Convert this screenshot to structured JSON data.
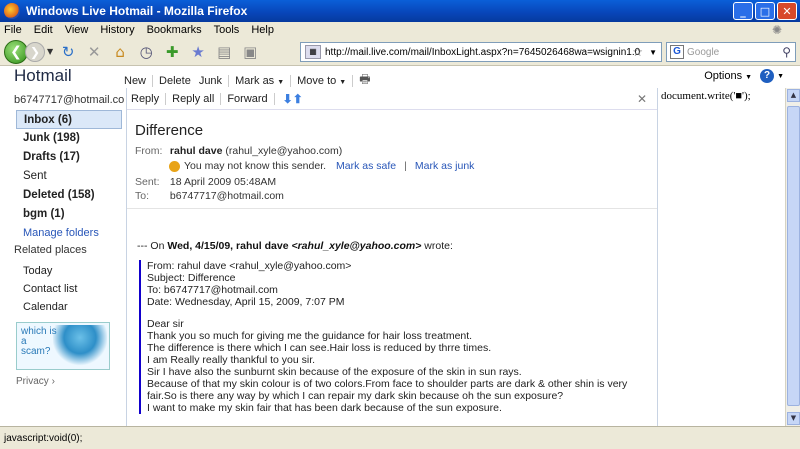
{
  "window": {
    "title": "Windows Live Hotmail - Mozilla Firefox"
  },
  "menu": [
    "File",
    "Edit",
    "View",
    "History",
    "Bookmarks",
    "Tools",
    "Help"
  ],
  "nav": {
    "url": "http://mail.live.com/mail/InboxLight.aspx?n=7645026468wa=wsignin1.0",
    "search_placeholder": "Google"
  },
  "hotmail": {
    "logo": "Hotmail",
    "actions": [
      "New",
      "Delete",
      "Junk",
      "Mark as",
      "Move to"
    ],
    "options": "Options"
  },
  "sidebar": {
    "account": "b6747717@hotmail.com",
    "folders": [
      {
        "label": "Inbox (6)"
      },
      {
        "label": "Junk (198)"
      },
      {
        "label": "Drafts (17)"
      },
      {
        "label": "Sent"
      },
      {
        "label": "Deleted (158)"
      },
      {
        "label": "bgm (1)"
      }
    ],
    "manage": "Manage folders",
    "related": "Related places",
    "places": [
      "Today",
      "Contact list",
      "Calendar"
    ],
    "ad_text": "which is a scam?",
    "privacy": "Privacy"
  },
  "message": {
    "toolbar": [
      "Reply",
      "Reply all",
      "Forward"
    ],
    "subject": "Difference",
    "from_label": "From:",
    "from_name": "rahul dave",
    "from_email": "(rahul_xyle@yahoo.com)",
    "warning": "You may not know this sender.",
    "mark_safe": "Mark as safe",
    "mark_junk": "Mark as junk",
    "sent_label": "Sent:",
    "sent": "18 April 2009 05:48AM",
    "to_label": "To:",
    "to": "b6747717@hotmail.com",
    "quote_prefix": "--- On ",
    "quote_date": "Wed, 4/15/09, rahul dave",
    "quote_email": "<rahul_xyle@yahoo.com>",
    "quote_suffix": " wrote:",
    "quoted_header": [
      "From: rahul dave <rahul_xyle@yahoo.com>",
      "Subject: Difference",
      "To: b6747717@hotmail.com",
      "Date: Wednesday, April 15, 2009, 7:07 PM"
    ],
    "body": [
      "Dear sir",
      "Thank you so much for giving me the guidance for hair loss treatment.",
      "The difference is there which I can see.Hair loss is reduced by thrre times.",
      "I am Really really thankful to you sir.",
      "Sir I have also the sunburnt skin because of the exposure of the skin in sun rays.",
      "Because of that my skin colour is of two colors.From face to shoulder parts are dark & other shin is very",
      "fair.So is there any way by which I can repair my dark skin because oh the sun exposure?",
      "I want to make my skin fair that has been dark because of the sun exposure."
    ]
  },
  "rightpanel": {
    "code": "document.write('■');"
  },
  "status": "javascript:void(0);"
}
